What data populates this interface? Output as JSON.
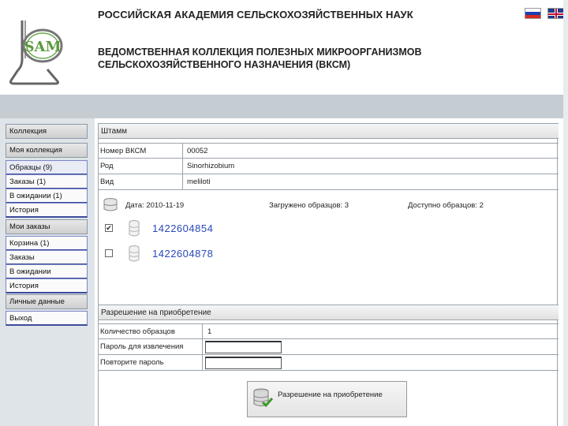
{
  "header": {
    "org_title": "РОССИЙСКАЯ АКАДЕМИЯ СЕЛЬСКОХОЗЯЙСТВЕННЫХ НАУК",
    "collection_title_line1": "ВЕДОМСТВЕННАЯ КОЛЛЕКЦИЯ ПОЛЕЗНЫХ МИКРООРГАНИЗМОВ",
    "collection_title_line2": "СЕЛЬСКОХОЗЯЙСТВЕННОГО НАЗНАЧЕНИЯ (ВКСМ)",
    "logo_text": "SAM"
  },
  "sidebar": {
    "collection": "Коллекция",
    "my_collection": "Моя коллекция",
    "my_collection_items": [
      "Образцы (9)",
      "Заказы (1)",
      "В ожидании (1)",
      "История"
    ],
    "my_orders": "Мои заказы",
    "my_orders_items": [
      "Корзина (1)",
      "Заказы",
      "В ожидании",
      "История"
    ],
    "personal_data": "Личные данные",
    "logout": "Выход"
  },
  "strain": {
    "section_title": "Штамм",
    "rows": [
      {
        "label": "Номер ВКСМ",
        "value": "00052"
      },
      {
        "label": "Род",
        "value": "Sinorhizobium"
      },
      {
        "label": "Вид",
        "value": "meliloti"
      }
    ],
    "date_label": "Дата: 2010-11-19",
    "loaded_label": "Загружено образцов: 3",
    "available_label": "Доступно образцов: 2"
  },
  "samples": [
    {
      "id": "1422604854",
      "checked": true
    },
    {
      "id": "1422604878",
      "checked": false
    }
  ],
  "permission": {
    "section_title": "Разрешение на приобретение",
    "count_label": "Количество образцов",
    "count_value": "1",
    "password_label": "Пароль для извлечения",
    "password_value": "",
    "repeat_label": "Повторите пароль",
    "repeat_value": "",
    "button_label": "Разрешение на приобретение"
  },
  "colors": {
    "sample_id": "#2848b8",
    "band": "#c5ccd2",
    "sidebar": "#dfe4e8"
  }
}
